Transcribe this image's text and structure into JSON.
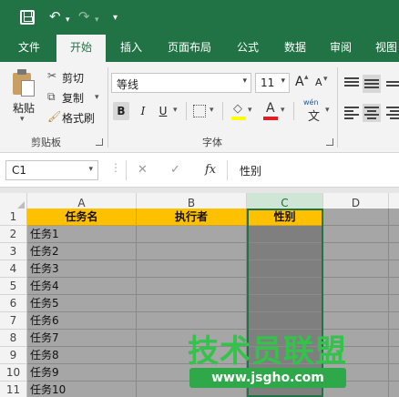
{
  "qat": {
    "undo_icon": "undo-icon",
    "redo_icon": "redo-icon",
    "customize": "▾"
  },
  "tabs": [
    {
      "label": "文件"
    },
    {
      "label": "开始"
    },
    {
      "label": "插入"
    },
    {
      "label": "页面布局"
    },
    {
      "label": "公式"
    },
    {
      "label": "数据"
    },
    {
      "label": "审阅"
    },
    {
      "label": "视图"
    }
  ],
  "ribbon": {
    "clipboard": {
      "paste": "粘贴",
      "cut": "剪切",
      "copy": "复制",
      "format_painter": "格式刷",
      "group": "剪贴板"
    },
    "font": {
      "name": "等线",
      "size": "11",
      "bold": "B",
      "italic": "I",
      "underline": "U",
      "grow": "A",
      "shrink": "A",
      "wen": "wén",
      "wen_char": "文",
      "group": "字体"
    }
  },
  "formula_bar": {
    "name_box": "C1",
    "cancel": "✕",
    "enter": "✓",
    "fx": "fx",
    "value": "性别"
  },
  "sheet": {
    "columns": [
      "A",
      "B",
      "C",
      "D"
    ],
    "rows": [
      "1",
      "2",
      "3",
      "4",
      "5",
      "6",
      "7",
      "8",
      "9",
      "10",
      "11"
    ],
    "header": [
      "任务名",
      "执行者",
      "性别"
    ],
    "tasks": [
      "任务1",
      "任务2",
      "任务3",
      "任务4",
      "任务5",
      "任务6",
      "任务7",
      "任务8",
      "任务9",
      "任务10"
    ]
  },
  "watermark": {
    "main": "技术员联盟",
    "url": "www.jsgho.com"
  },
  "colors": {
    "excel_green": "#217346",
    "header_fill": "#ffc000",
    "cell_gray": "#a6a6a6",
    "selected_col": "#7f7f7f"
  }
}
